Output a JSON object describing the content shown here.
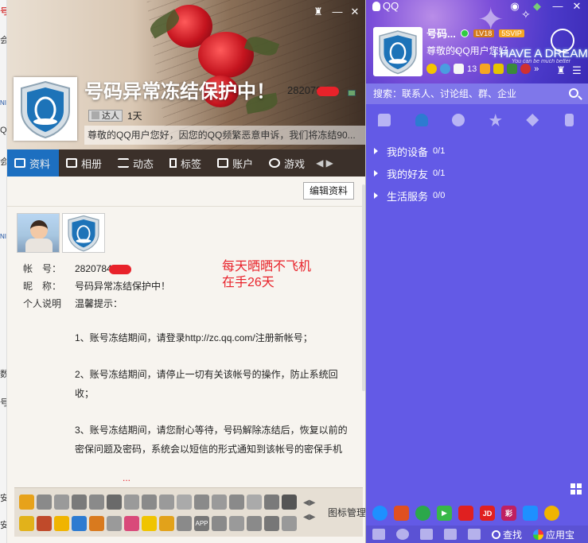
{
  "background_window": {
    "fragments": [
      "号",
      "会",
      "NI",
      "Q",
      "会",
      "NI",
      "数",
      "号",
      "安",
      "安"
    ]
  },
  "profile": {
    "name": "号码异常冻结保护中！",
    "qq_number": "282078",
    "badge_label": "达人",
    "badge_days": "1天",
    "notice": "尊敬的QQ用户您好，因您的QQ频繁恶意申诉，我们将冻结90...",
    "tabs": [
      {
        "label": "资料",
        "icon": "profile-card-icon"
      },
      {
        "label": "相册",
        "icon": "photo-album-icon"
      },
      {
        "label": "动态",
        "icon": "feed-list-icon"
      },
      {
        "label": "标签",
        "icon": "bookmark-tag-icon"
      },
      {
        "label": "账户",
        "icon": "wallet-icon"
      },
      {
        "label": "游戏",
        "icon": "game-icon"
      }
    ],
    "tab_more": "◀ ▶",
    "edit_button": "编辑资料",
    "fields": [
      {
        "key": "帐　号：",
        "value": "2820784"
      },
      {
        "key": "昵　称：",
        "value": "号码异常冻结保护中！"
      },
      {
        "key": "个人说明",
        "value": "温馨提示："
      }
    ],
    "remark": [
      "每天晒晒不飞机",
      "在手26天"
    ],
    "body": [
      "1、账号冻结期间，请登录http://zc.qq.com/注册新帐号；",
      "2、账号冻结期间，请停止一切有关该帐号的操作，防止系统回收；",
      "3、账号冻结期间，请您耐心等待，号码解除冻结后，恢复以前的密保问题及密码，系统会以短信的形式通知到该帐号的密保手机"
    ],
    "ellipsis": "...",
    "icon_manager": "图标管理",
    "icon_nav": "◀▶"
  },
  "qq": {
    "app_name": "QQ",
    "nickname": "号码...",
    "level_badge": "LV18",
    "vip_badge": "5SVIP",
    "signature": "尊敬的QQ用户您好",
    "theme_text": "I HAVE A DREAM",
    "theme_sub": "You can be much better",
    "mail_count": "13",
    "search_placeholder": "搜索：联系人、讨论组、群、企业",
    "groups": [
      {
        "label": "我的设备",
        "count": "0/1"
      },
      {
        "label": "我的好友",
        "count": "0/1"
      },
      {
        "label": "生活服务",
        "count": "0/0"
      }
    ],
    "apps": [
      "JD",
      "彩"
    ],
    "find_label": "查找",
    "appstore_label": "应用宝"
  }
}
